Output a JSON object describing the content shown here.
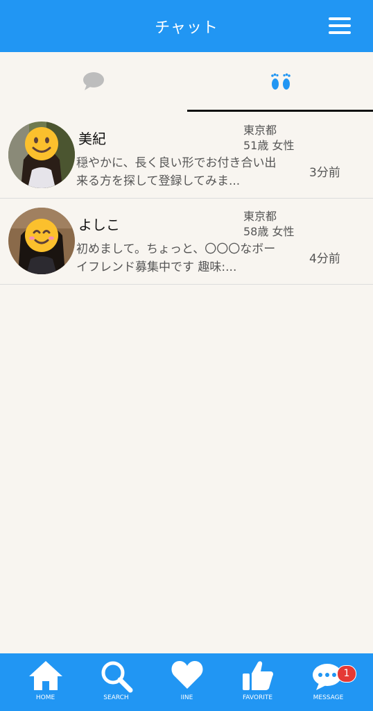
{
  "header": {
    "title": "チャット"
  },
  "tabs": [
    {
      "name": "chat",
      "icon": "speech-bubble-icon",
      "active": false
    },
    {
      "name": "footprints",
      "icon": "footprints-icon",
      "active": true
    }
  ],
  "chats": [
    {
      "name": "美紀",
      "location": "東京都",
      "info": "51歳 女性",
      "message": "穏やかに、長く良い形でお付き合い出来る方を探して登録してみま...",
      "time": "3分前"
    },
    {
      "name": "よしこ",
      "location": "東京都",
      "info": "58歳 女性",
      "message": "初めまして。ちょっと、〇〇〇なボーイフレンド募集中です 趣味:...",
      "time": "4分前"
    }
  ],
  "nav": [
    {
      "label": "HOME",
      "icon": "home-icon"
    },
    {
      "label": "SEARCH",
      "icon": "search-icon"
    },
    {
      "label": "IINE",
      "icon": "heart-icon"
    },
    {
      "label": "FAVORITE",
      "icon": "thumbs-up-icon"
    },
    {
      "label": "MESSAGE",
      "icon": "message-icon",
      "badge": "1"
    }
  ],
  "colors": {
    "primary": "#2196f3",
    "background": "#f8f5f0",
    "badge": "#e53935",
    "footprint": "#2196f3"
  }
}
